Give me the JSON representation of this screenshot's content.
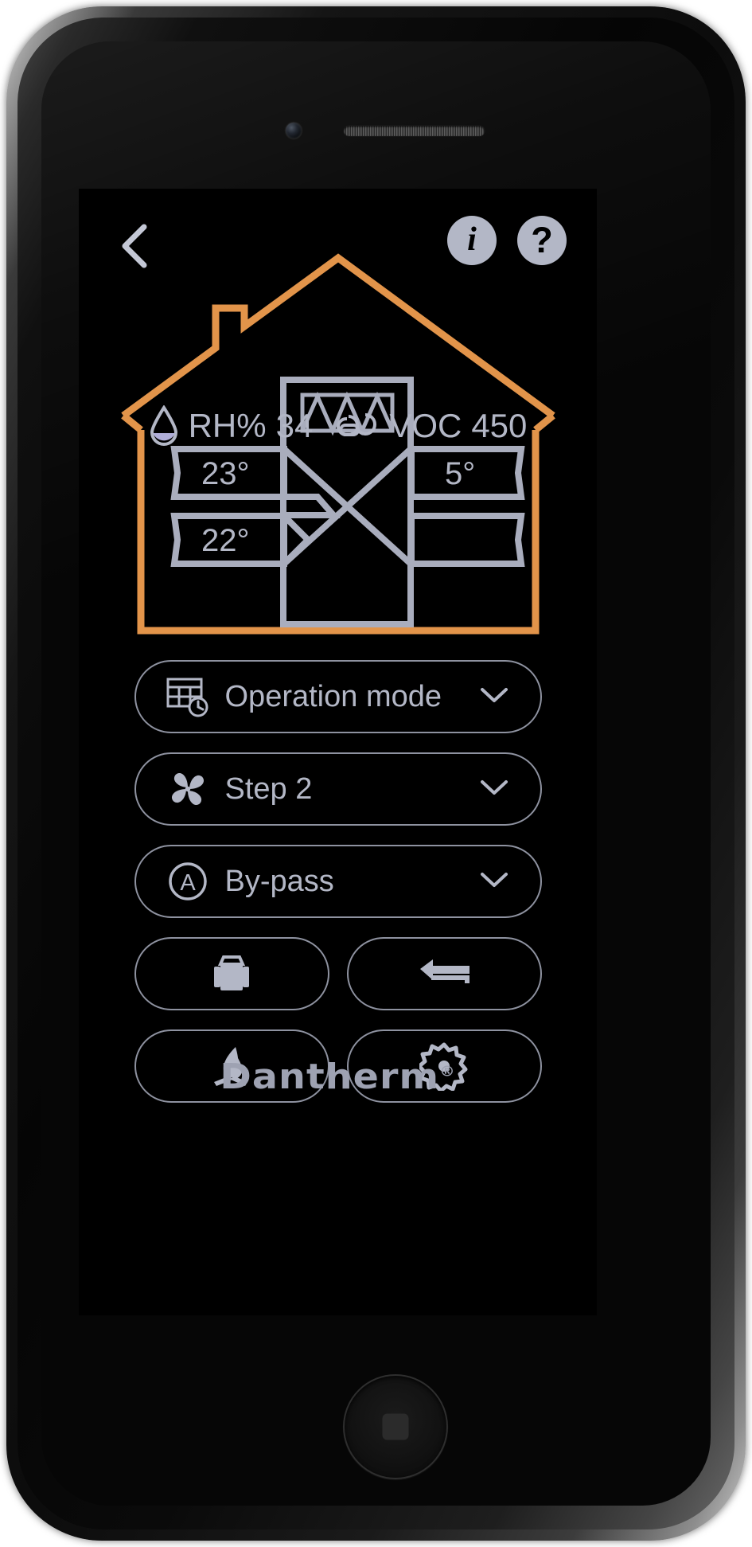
{
  "app": {
    "brand_name": "Dantherm",
    "brand_mark": "®"
  },
  "topbar": {
    "back_label": "‹",
    "info_label": "i",
    "help_label": "?",
    "info_name": "info-icon",
    "help_name": "help-icon"
  },
  "sensors": {
    "humidity": {
      "icon": "water-drop-icon",
      "label": "RH%",
      "value": "34"
    },
    "air_quality": {
      "icon": "cloud-icon",
      "label": "VOC",
      "value": "450"
    }
  },
  "diagram": {
    "name": "heat-exchanger-diagram",
    "house_outline_color": "#e2944a",
    "duct_color": "#a9adbd",
    "temperatures": {
      "supply_in": "23°",
      "extract_out": "5°",
      "supply_out": "22°"
    }
  },
  "controls": [
    {
      "id": "operation-mode",
      "icon": "calendar-clock-icon",
      "label": "Operation mode",
      "chevron": "chevron-down-icon"
    },
    {
      "id": "fan-step",
      "icon": "fan-icon",
      "label": "Step 2",
      "chevron": "chevron-down-icon"
    },
    {
      "id": "bypass",
      "icon": "auto-a-icon",
      "label": "By-pass",
      "chevron": "chevron-down-icon"
    }
  ],
  "quick_actions": [
    {
      "id": "away-mode",
      "icon": "suitcase-icon"
    },
    {
      "id": "night-mode",
      "icon": "bed-icon"
    },
    {
      "id": "fireplace-mode",
      "icon": "fireplace-icon"
    },
    {
      "id": "settings",
      "icon": "gear-icon"
    }
  ],
  "colors": {
    "accent_orange": "#e2944a",
    "foreground": "#b3b7c6",
    "outline": "#8e92a0",
    "background": "#000000",
    "drop_fill": "#b0aed8"
  }
}
